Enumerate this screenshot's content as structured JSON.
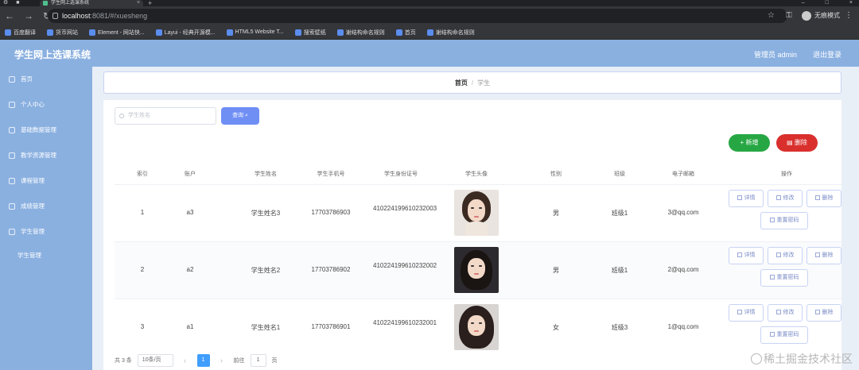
{
  "browser": {
    "tab_title": "学生网上选课系统",
    "url_host": "localhost",
    "url_path": ":8081/#/xuesheng",
    "profile_label": "无痕模式",
    "bookmarks": [
      "百度翻译",
      "货币网站",
      "Element - 网站快...",
      "Layui - 经典开源模...",
      "HTML5 Website T...",
      "搜索壁纸",
      "谢结构命名规则",
      "首页",
      "谢结构命名规则"
    ]
  },
  "header": {
    "title": "学生网上选课系统",
    "user_label": "管理员 admin",
    "logout_label": "退出登录"
  },
  "sidebar": {
    "items": [
      {
        "label": "首页"
      },
      {
        "label": "个人中心"
      },
      {
        "label": "基础数据管理"
      },
      {
        "label": "教学资源管理"
      },
      {
        "label": "课程管理"
      },
      {
        "label": "成绩管理"
      },
      {
        "label": "学生管理"
      },
      {
        "label": "学生管理"
      }
    ]
  },
  "breadcrumb": {
    "home": "首页",
    "sep": "/",
    "current": "学生"
  },
  "toolbar": {
    "search_placeholder": "学生姓名",
    "search_label": "查询",
    "add_label": "新增",
    "delete_label": "删除"
  },
  "table": {
    "columns": [
      "索引",
      "账户",
      "学生姓名",
      "学生手机号",
      "学生身份证号",
      "学生头像",
      "性别",
      "班级",
      "电子邮箱",
      "操作"
    ],
    "rows": [
      {
        "index": "1",
        "account": "a3",
        "name": "学生姓名3",
        "phone": "17703786903",
        "id_number": "410224199610232003",
        "gender": "男",
        "class": "班级1",
        "email": "3@qq.com"
      },
      {
        "index": "2",
        "account": "a2",
        "name": "学生姓名2",
        "phone": "17703786902",
        "id_number": "410224199610232002",
        "gender": "男",
        "class": "班级1",
        "email": "2@qq.com"
      },
      {
        "index": "3",
        "account": "a1",
        "name": "学生姓名1",
        "phone": "17703786901",
        "id_number": "410224199610232001",
        "gender": "女",
        "class": "班级3",
        "email": "1@qq.com"
      }
    ],
    "actions": {
      "detail": "详情",
      "edit": "修改",
      "delete": "删除",
      "reset_pwd": "重置密码"
    }
  },
  "pagination": {
    "total_text": "共 3 条",
    "page_size": "10条/页",
    "prev": "‹",
    "current_page": "1",
    "next": "›",
    "goto_label": "前往",
    "goto_value": "1",
    "page_suffix": "页"
  },
  "watermark": "稀土掘金技术社区",
  "colors": {
    "sidebar": "#8ab0e0",
    "primary": "#6f8ff5",
    "success": "#27a744",
    "danger": "#d9302d"
  }
}
